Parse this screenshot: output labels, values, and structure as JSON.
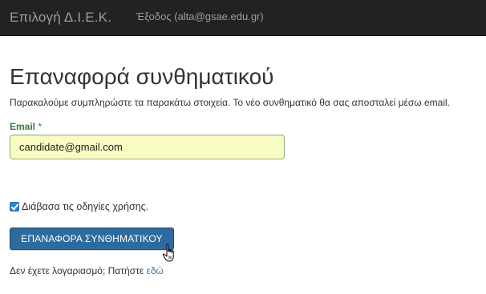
{
  "navbar": {
    "brand": "Επιλογή Δ.Ι.Ε.Κ.",
    "logout": "Έξοδος (alta@gsae.edu.gr)"
  },
  "page": {
    "title": "Επαναφορά συνθηματικού",
    "intro": "Παρακαλούμε συμπληρώστε τα παρακάτω στοιχεία. Το νέο συνθηματικό θα σας αποσταλεί μέσω email."
  },
  "form": {
    "email_label": "Email",
    "required_mark": "*",
    "email_value": "candidate@gmail.com",
    "terms_checked": true,
    "terms_label": "Διάβασα τις οδηγίες χρήσης.",
    "submit_label": "ΕΠΑΝΑΦΟΡΑ ΣΥΝΘΗΜΑΤΙΚΟΥ"
  },
  "footer": {
    "signup_text": "Δεν έχετε λογαριασμό; Πατήστε",
    "signup_link": "εδώ"
  },
  "colors": {
    "navbar_bg": "#222222",
    "input_bg": "#fbfcc4",
    "button_bg": "#2d6b9f",
    "link": "#337ab7",
    "label_success": "#3c763d"
  },
  "icons": {
    "checkbox": "checkbox-checked-icon",
    "cursor": "hand-pointer-icon"
  }
}
